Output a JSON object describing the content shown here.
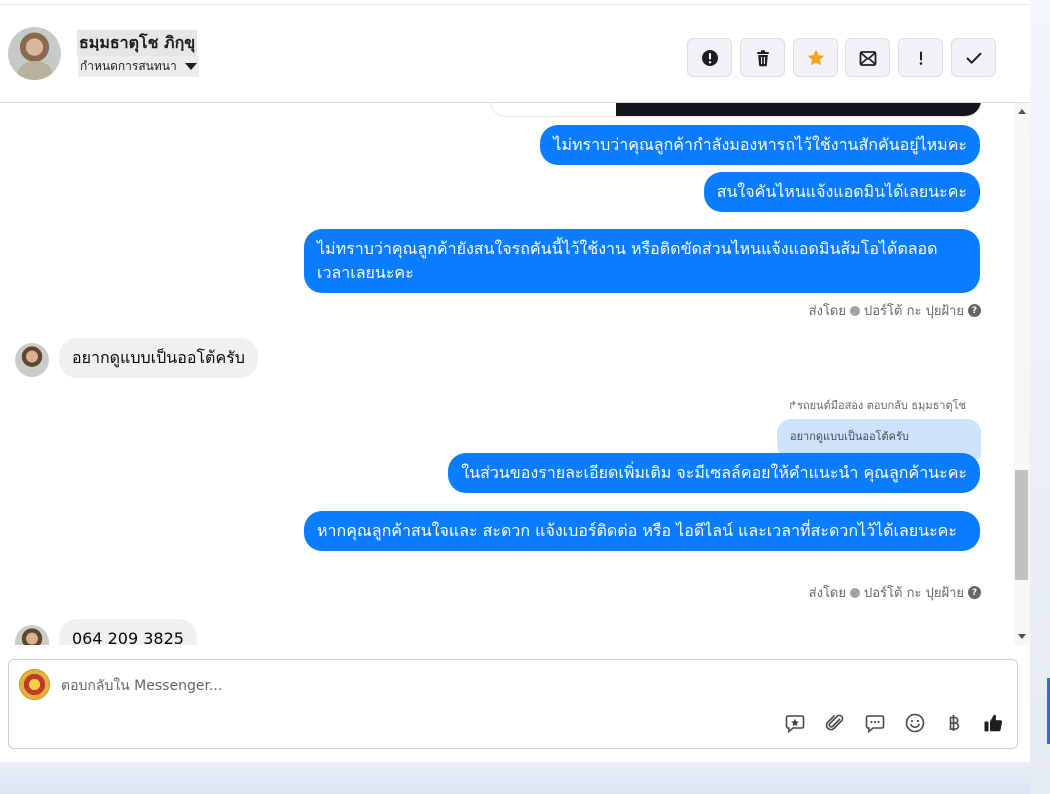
{
  "header": {
    "contact_name": "ธมฺมธาตุโช ภิกฺขุ",
    "conversation_settings": "กำหนดการสนทนา",
    "actions": [
      {
        "icon": "alert-circle-icon",
        "name": "mark-spam-button"
      },
      {
        "icon": "trash-icon",
        "name": "delete-button"
      },
      {
        "icon": "star-icon",
        "name": "star-button"
      },
      {
        "icon": "mail-unread-icon",
        "name": "mark-unread-button"
      },
      {
        "icon": "exclamation-icon",
        "name": "follow-up-button"
      },
      {
        "icon": "checkmark-icon",
        "name": "mark-done-button"
      }
    ],
    "star_color": "#f7a21b"
  },
  "messages": {
    "out_1": "ไม่ทราบว่าคุณลูกค้ากำลังมองหารถไว้ใช้งานสักคันอยู่ไหมคะ",
    "out_2": "สนใจคันไหนแจ้งแอดมินได้เลยนะคะ",
    "out_3": "ไม่ทราบว่าคุณลูกค้ายังสนใจรถคันนี้ไว้ใช้งาน หรือติดขัดส่วนไหนแจ้งแอดมินส้มโอได้ตลอดเวลาเลยนะคะ",
    "sent_by_label": "ส่งโดย",
    "sent_by_name": "ปอร์โต้ กะ ปุยฝ้าย",
    "in_1": "อยากดูแบบเป็นออโต้ครับ",
    "reply_meta": "รถยนต์มือสอง ตอบกลับ ธมฺมธาตุโช",
    "reply_quote": "อยากดูแบบเป็นออโต้ครับ",
    "out_4": "ในส่วนของรายละเอียดเพิ่มเติม จะมีเซลล์คอยให้คำแนะนำ คุณลูกค้านะคะ",
    "out_5": "หากคุณลูกค้าสนใจและ สะดวก แจ้งเบอร์ติดต่อ หรือ ไอดีไลน์ และเวลาที่สะดวกไว้ได้เลยนะคะ",
    "in_2": "064 209 3825"
  },
  "composer": {
    "placeholder": "ตอบกลับใน Messenger...",
    "tools": [
      "saved-reply-icon",
      "attachment-icon",
      "chat-bubble-icon",
      "emoji-icon",
      "baht-icon",
      "thumbs-up-icon"
    ]
  },
  "colors": {
    "outgoing_bubble": "#0a7cff",
    "incoming_bubble": "#f0f0f0"
  }
}
